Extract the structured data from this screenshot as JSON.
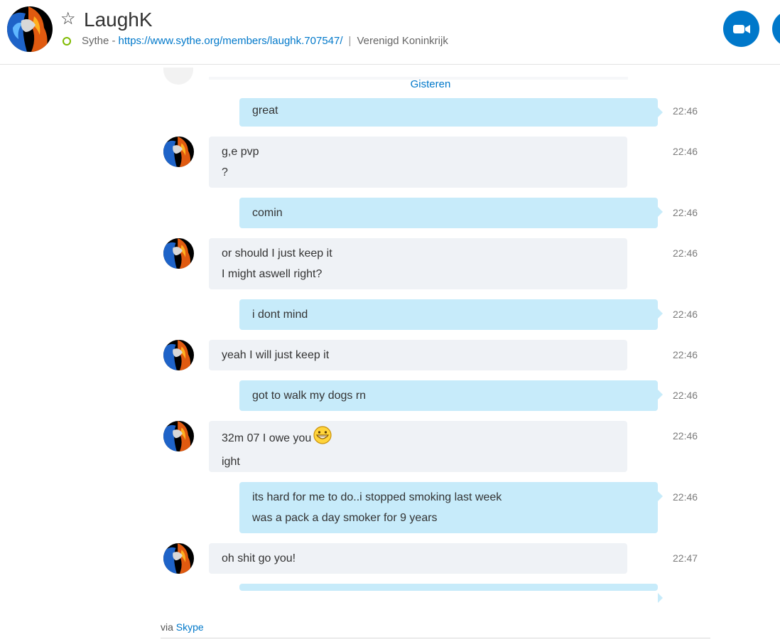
{
  "header": {
    "name": "LaughK",
    "status_prefix": "Sythe -",
    "status_link": "https://www.sythe.org/members/laughk.707547/",
    "separator": "|",
    "location": "Verenigd Koninkrijk",
    "presence_color": "#7fba00",
    "accent_color": "#0078ca"
  },
  "chat": {
    "date_divider": "Gisteren",
    "messages": [
      {
        "from": "me",
        "lines": [
          "great"
        ],
        "time": "22:46"
      },
      {
        "from": "them",
        "lines": [
          "g,e pvp",
          "?"
        ],
        "time": "22:46"
      },
      {
        "from": "me",
        "lines": [
          "comin"
        ],
        "time": "22:46"
      },
      {
        "from": "them",
        "lines": [
          "or should I just keep it",
          "I might aswell right?"
        ],
        "time": "22:46"
      },
      {
        "from": "me",
        "lines": [
          "i dont mind"
        ],
        "time": "22:46"
      },
      {
        "from": "them",
        "lines": [
          "yeah I will just keep it"
        ],
        "time": "22:46"
      },
      {
        "from": "me",
        "lines": [
          "got to walk my dogs rn"
        ],
        "time": "22:46"
      },
      {
        "from": "them",
        "lines": [
          "32m 07 I owe you",
          "ight"
        ],
        "time": "22:46",
        "emoji": "grin-emoji"
      },
      {
        "from": "me",
        "lines": [
          "its hard for me to do..i stopped smoking last week",
          "was a pack a day smoker for 9 years"
        ],
        "time": "22:46"
      },
      {
        "from": "them",
        "lines": [
          "oh shit go you!"
        ],
        "time": "22:47"
      }
    ]
  },
  "footer": {
    "via": "via",
    "app": "Skype"
  }
}
